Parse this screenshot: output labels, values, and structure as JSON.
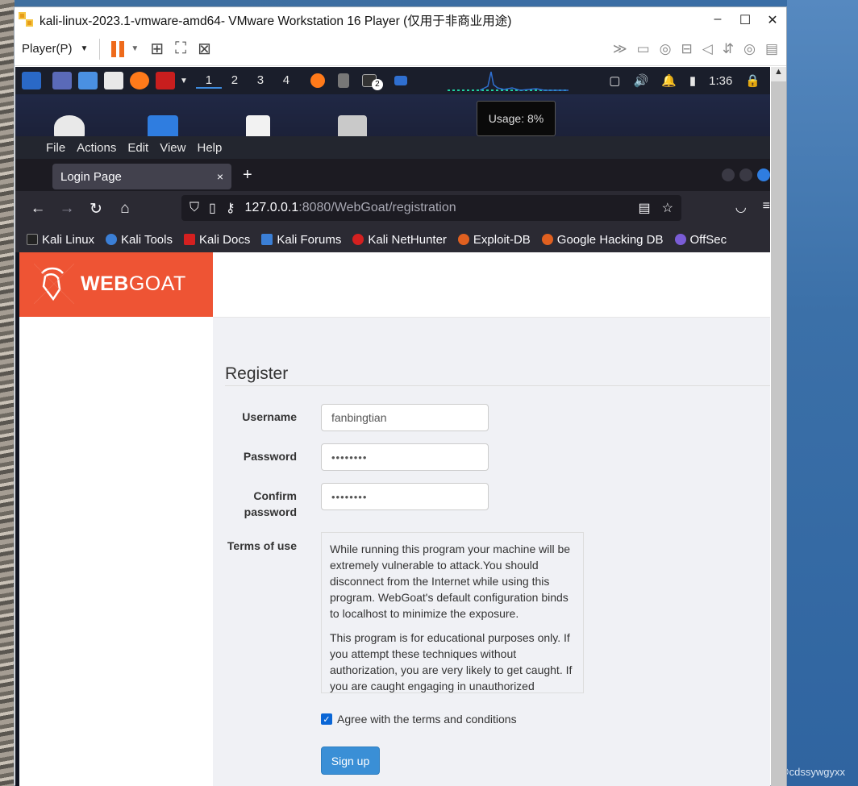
{
  "vmware": {
    "title": "kali-linux-2023.1-vmware-amd64- VMware Workstation 16 Player (仅用于非商业用途)",
    "player_menu": "Player(P)",
    "controls": {
      "minimize": "–",
      "maximize": "☐",
      "close": "✕"
    }
  },
  "kali_panel": {
    "workspaces": [
      "1",
      "2",
      "3",
      "4"
    ],
    "active_workspace": "1",
    "terminal_badge": "2",
    "clock": "1:36",
    "cpu_tooltip": "Usage: 8%"
  },
  "file_manager_menu": [
    "File",
    "Actions",
    "Edit",
    "View",
    "Help"
  ],
  "firefox": {
    "tab_title": "Login Page",
    "tab_close": "×",
    "new_tab": "+",
    "url_host": "127.0.0.1",
    "url_path": ":8080/WebGoat/registration",
    "bookmarks": [
      {
        "label": "Kali Linux",
        "color": "#222222"
      },
      {
        "label": "Kali Tools",
        "color": "#3b7fd6"
      },
      {
        "label": "Kali Docs",
        "color": "#d42020"
      },
      {
        "label": "Kali Forums",
        "color": "#3b7fd6"
      },
      {
        "label": "Kali NetHunter",
        "color": "#d42020"
      },
      {
        "label": "Exploit-DB",
        "color": "#e06020"
      },
      {
        "label": "Google Hacking DB",
        "color": "#e06020"
      },
      {
        "label": "OffSec",
        "color": "#7a5cd6"
      }
    ]
  },
  "webgoat": {
    "logo_web": "WEB",
    "logo_goat": "GOAT",
    "brand_color": "#ee5434",
    "form_title": "Register",
    "username_label": "Username",
    "username_value": "fanbingtian",
    "password_label": "Password",
    "password_value": "••••••••",
    "confirm_label_1": "Confirm",
    "confirm_label_2": "password",
    "confirm_value": "••••••••",
    "terms_label": "Terms of use",
    "terms_p1": "While running this program your machine will be extremely vulnerable to attack.You should disconnect from the Internet while using this program. WebGoat's default configuration binds to localhost to minimize the exposure.",
    "terms_p2": "This program is for educational purposes only. If you attempt these techniques without authorization, you are very likely to get caught. If you are caught engaging in unauthorized",
    "agree_label": "Agree with the terms and conditions",
    "agree_checked": true,
    "signup_label": "Sign up"
  },
  "watermark": "CSDN @cdssywgyxx"
}
